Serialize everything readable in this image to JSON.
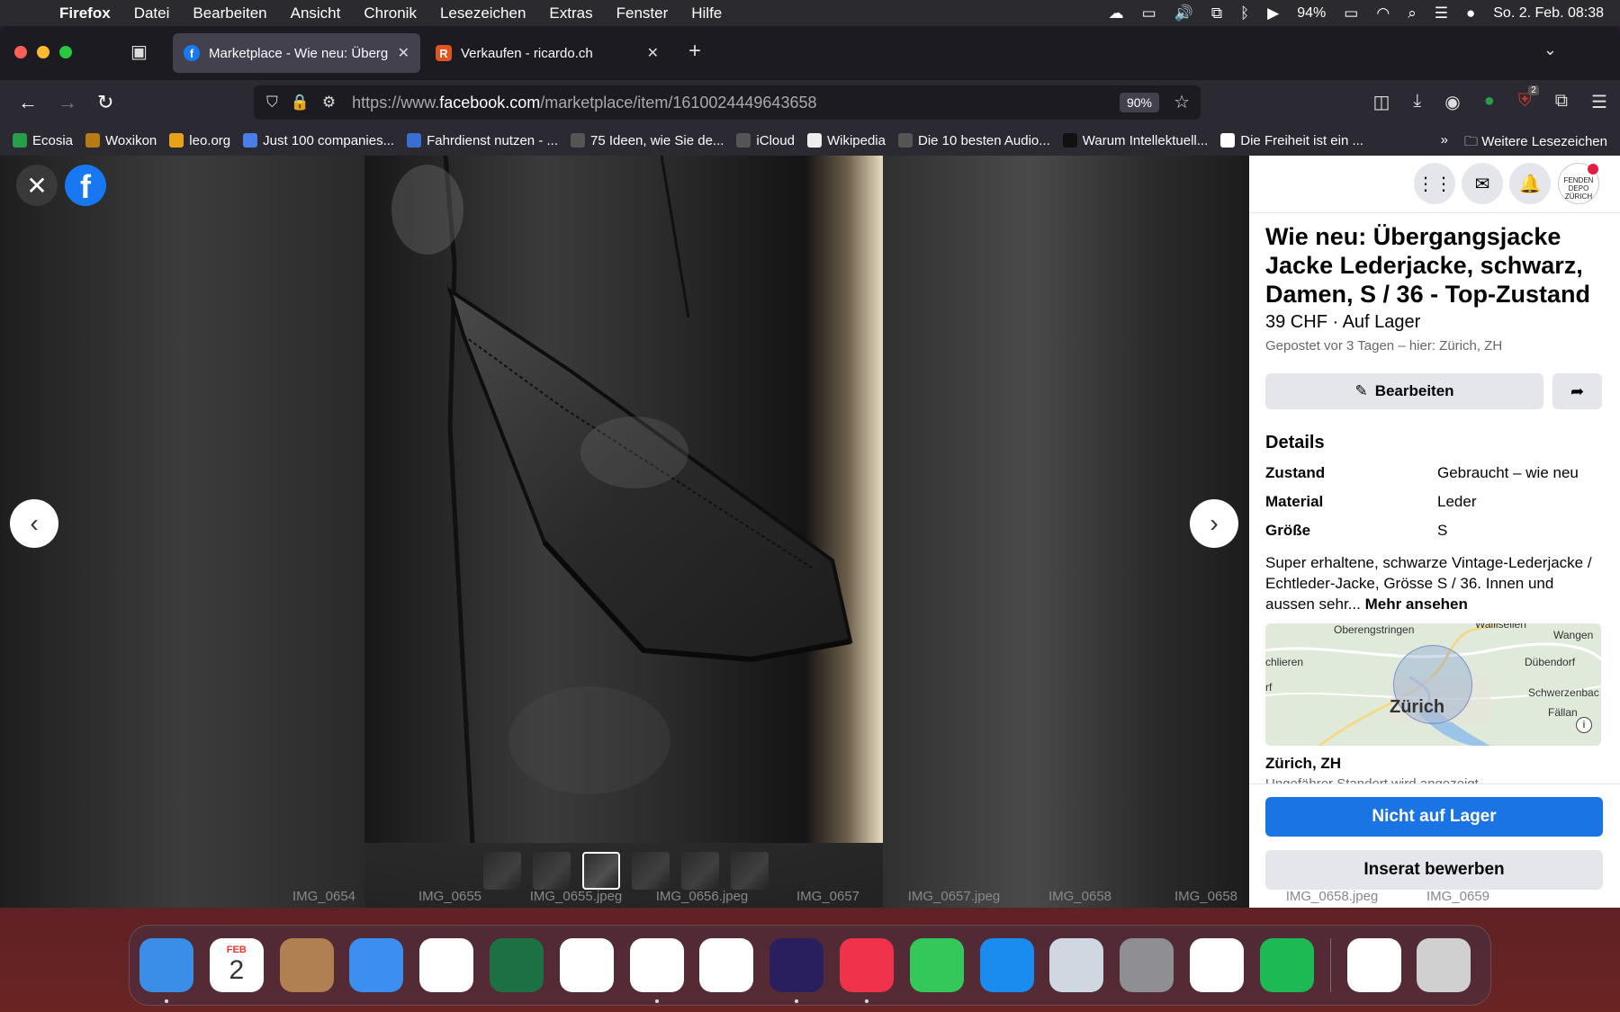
{
  "menubar": {
    "app": "Firefox",
    "items": [
      "Datei",
      "Bearbeiten",
      "Ansicht",
      "Chronik",
      "Lesezeichen",
      "Extras",
      "Fenster",
      "Hilfe"
    ],
    "battery": "94%",
    "datetime": "So. 2. Feb. 08:38"
  },
  "tabs": [
    {
      "title": "Marketplace - Wie neu: Übergar",
      "active": true
    },
    {
      "title": "Verkaufen - ricardo.ch",
      "active": false
    }
  ],
  "urlbar": {
    "prefix": "https://www.",
    "domain": "facebook.com",
    "path": "/marketplace/item/1610024449643658",
    "zoom": "90%"
  },
  "toolbar": {
    "extension_badge": "2"
  },
  "bookmarks": [
    {
      "label": "Ecosia",
      "icon": "ecosia-icon",
      "color": "#2a9d4a"
    },
    {
      "label": "Woxikon",
      "icon": "woxikon-icon",
      "color": "#b87a12"
    },
    {
      "label": "leo.org",
      "icon": "leo-icon",
      "color": "#e8a21a"
    },
    {
      "label": "Just 100 companies...",
      "icon": "g-icon",
      "color": "#4a7de8"
    },
    {
      "label": "Fahrdienst nutzen - ...",
      "icon": "wheelchair-icon",
      "color": "#3a6ed0"
    },
    {
      "label": "75 Ideen, wie Sie de...",
      "icon": "globe-icon",
      "color": "#555"
    },
    {
      "label": "iCloud",
      "icon": "apple-icon",
      "color": "#555"
    },
    {
      "label": "Wikipedia",
      "icon": "wikipedia-icon",
      "color": "#eee"
    },
    {
      "label": "Die 10 besten Audio...",
      "icon": "globe-icon",
      "color": "#555"
    },
    {
      "label": "Warum Intellektuell...",
      "icon": "nzz-icon",
      "color": "#111"
    },
    {
      "label": "Die Freiheit ist ein ...",
      "icon": "r-icon",
      "color": "#fff"
    }
  ],
  "bookmarks_more": "Weitere Lesezeichen",
  "listing": {
    "title": "Wie neu: Übergangsjacke Jacke Lederjacke, schwarz, Damen, S / 36 - Top-Zustand",
    "price": "39 CHF · Auf Lager",
    "posted": "Gepostet vor 3 Tagen – hier: Zürich, ZH",
    "edit_label": "Bearbeiten",
    "details_heading": "Details",
    "details": [
      {
        "key": "Zustand",
        "value": "Gebraucht – wie neu"
      },
      {
        "key": "Material",
        "value": "Leder"
      },
      {
        "key": "Größe",
        "value": "S"
      }
    ],
    "description": "Super erhaltene, schwarze Vintage-Lederjacke / Echtleder-Jacke, Grösse S / 36. Innen und aussen sehr...",
    "more_label": "Mehr ansehen",
    "map_labels": [
      "Oberengstringen",
      "Wallisellen",
      "Wangen",
      "chlieren",
      "Dübendorf",
      "rf",
      "Schwerzenbac",
      "Zürich",
      "Fällan"
    ],
    "location": "Zürich, ZH",
    "location_sub": "Ungefährer Standort wird angezeigt",
    "primary_button": "Nicht auf Lager",
    "secondary_button": "Inserat bewerben"
  },
  "avatar_text": "FENDEN DEPO ZÜRICH",
  "finder_files": [
    "IMG_0654",
    "IMG_0655",
    "IMG_0655.jpeg",
    "IMG_0656.jpeg",
    "IMG_0657",
    "IMG_0657.jpeg",
    "IMG_0658",
    "IMG_0658",
    "IMG_0658.jpeg",
    "IMG_0659"
  ],
  "dock": {
    "calendar_month": "FEB",
    "calendar_day": "2",
    "apps": [
      {
        "name": "Finder",
        "color": "#3a8ee6"
      },
      {
        "name": "Calendar",
        "color": "#ffffff"
      },
      {
        "name": "Contacts",
        "color": "#b08050"
      },
      {
        "name": "Mail",
        "color": "#3c8ef0"
      },
      {
        "name": "Safari",
        "color": "#ffffff"
      },
      {
        "name": "Excel",
        "color": "#1d7044"
      },
      {
        "name": "Reminders",
        "color": "#ffffff"
      },
      {
        "name": "Word",
        "color": "#ffffff"
      },
      {
        "name": "Photos",
        "color": "#ffffff"
      },
      {
        "name": "Firefox",
        "color": "#2a1f5e"
      },
      {
        "name": "Music",
        "color": "#f0324a"
      },
      {
        "name": "Messages",
        "color": "#34c759"
      },
      {
        "name": "App Store",
        "color": "#1a8cf0"
      },
      {
        "name": "Preview",
        "color": "#cfd8e0"
      },
      {
        "name": "System Settings",
        "color": "#8e8e93"
      },
      {
        "name": "Messenger",
        "color": "#ffffff"
      },
      {
        "name": "Spotify",
        "color": "#1db954"
      },
      {
        "name": "Word Document",
        "color": "#ffffff"
      },
      {
        "name": "Trash",
        "color": "#d0d0d0"
      }
    ]
  }
}
